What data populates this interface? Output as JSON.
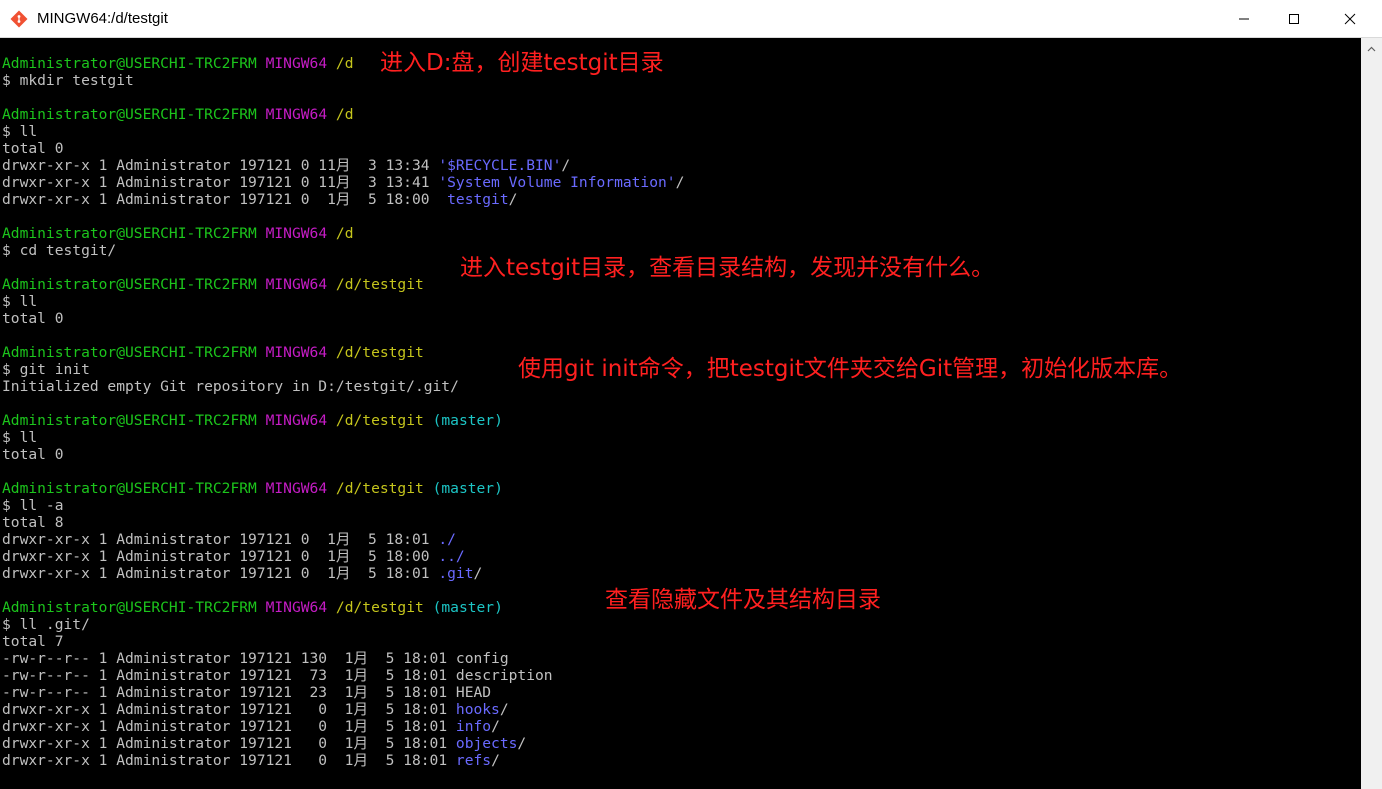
{
  "window": {
    "title": "MINGW64:/d/testgit",
    "minimize_icon": "minimize-icon",
    "maximize_icon": "maximize-icon",
    "close_icon": "close-icon"
  },
  "colors": {
    "background": "#000000",
    "prompt_user": "#1cc51c",
    "prompt_system": "#c51cc5",
    "prompt_path": "#c5c51c",
    "git_branch": "#1cc5c5",
    "directory": "#6a6aff",
    "text": "#c0c0c0",
    "annotation": "#ff2020"
  },
  "terminal": {
    "lines": [
      [
        [
          "Administrator@USERCHI-TRC2FRM",
          "green"
        ],
        [
          " ",
          "white"
        ],
        [
          "MINGW64",
          "magenta"
        ],
        [
          " ",
          "white"
        ],
        [
          "/d",
          "yellow"
        ]
      ],
      [
        [
          "$ mkdir testgit",
          "white"
        ]
      ],
      [],
      [
        [
          "Administrator@USERCHI-TRC2FRM",
          "green"
        ],
        [
          " ",
          "white"
        ],
        [
          "MINGW64",
          "magenta"
        ],
        [
          " ",
          "white"
        ],
        [
          "/d",
          "yellow"
        ]
      ],
      [
        [
          "$ ll",
          "white"
        ]
      ],
      [
        [
          "total 0",
          "white"
        ]
      ],
      [
        [
          "drwxr-xr-x 1 Administrator 197121 0 11月  3 13:34 ",
          "white"
        ],
        [
          "'$RECYCLE.BIN'",
          "blue"
        ],
        [
          "/",
          "white"
        ]
      ],
      [
        [
          "drwxr-xr-x 1 Administrator 197121 0 11月  3 13:41 ",
          "white"
        ],
        [
          "'System Volume Information'",
          "blue"
        ],
        [
          "/",
          "white"
        ]
      ],
      [
        [
          "drwxr-xr-x 1 Administrator 197121 0  1月  5 18:00  ",
          "white"
        ],
        [
          "testgit",
          "blue"
        ],
        [
          "/",
          "white"
        ]
      ],
      [],
      [
        [
          "Administrator@USERCHI-TRC2FRM",
          "green"
        ],
        [
          " ",
          "white"
        ],
        [
          "MINGW64",
          "magenta"
        ],
        [
          " ",
          "white"
        ],
        [
          "/d",
          "yellow"
        ]
      ],
      [
        [
          "$ cd testgit/",
          "white"
        ]
      ],
      [],
      [
        [
          "Administrator@USERCHI-TRC2FRM",
          "green"
        ],
        [
          " ",
          "white"
        ],
        [
          "MINGW64",
          "magenta"
        ],
        [
          " ",
          "white"
        ],
        [
          "/d/testgit",
          "yellow"
        ]
      ],
      [
        [
          "$ ll",
          "white"
        ]
      ],
      [
        [
          "total 0",
          "white"
        ]
      ],
      [],
      [
        [
          "Administrator@USERCHI-TRC2FRM",
          "green"
        ],
        [
          " ",
          "white"
        ],
        [
          "MINGW64",
          "magenta"
        ],
        [
          " ",
          "white"
        ],
        [
          "/d/testgit",
          "yellow"
        ]
      ],
      [
        [
          "$ git init",
          "white"
        ]
      ],
      [
        [
          "Initialized empty Git repository in D:/testgit/.git/",
          "white"
        ]
      ],
      [],
      [
        [
          "Administrator@USERCHI-TRC2FRM",
          "green"
        ],
        [
          " ",
          "white"
        ],
        [
          "MINGW64",
          "magenta"
        ],
        [
          " ",
          "white"
        ],
        [
          "/d/testgit",
          "yellow"
        ],
        [
          " ",
          "white"
        ],
        [
          "(master)",
          "cyan"
        ]
      ],
      [
        [
          "$ ll",
          "white"
        ]
      ],
      [
        [
          "total 0",
          "white"
        ]
      ],
      [],
      [
        [
          "Administrator@USERCHI-TRC2FRM",
          "green"
        ],
        [
          " ",
          "white"
        ],
        [
          "MINGW64",
          "magenta"
        ],
        [
          " ",
          "white"
        ],
        [
          "/d/testgit",
          "yellow"
        ],
        [
          " ",
          "white"
        ],
        [
          "(master)",
          "cyan"
        ]
      ],
      [
        [
          "$ ll -a",
          "white"
        ]
      ],
      [
        [
          "total 8",
          "white"
        ]
      ],
      [
        [
          "drwxr-xr-x 1 Administrator 197121 0  1月  5 18:01 ",
          "white"
        ],
        [
          "./",
          "blue"
        ]
      ],
      [
        [
          "drwxr-xr-x 1 Administrator 197121 0  1月  5 18:00 ",
          "white"
        ],
        [
          "../",
          "blue"
        ]
      ],
      [
        [
          "drwxr-xr-x 1 Administrator 197121 0  1月  5 18:01 ",
          "white"
        ],
        [
          ".git",
          "blue"
        ],
        [
          "/",
          "white"
        ]
      ],
      [],
      [
        [
          "Administrator@USERCHI-TRC2FRM",
          "green"
        ],
        [
          " ",
          "white"
        ],
        [
          "MINGW64",
          "magenta"
        ],
        [
          " ",
          "white"
        ],
        [
          "/d/testgit",
          "yellow"
        ],
        [
          " ",
          "white"
        ],
        [
          "(master)",
          "cyan"
        ]
      ],
      [
        [
          "$ ll .git/",
          "white"
        ]
      ],
      [
        [
          "total 7",
          "white"
        ]
      ],
      [
        [
          "-rw-r--r-- 1 Administrator 197121 130  1月  5 18:01 config",
          "white"
        ]
      ],
      [
        [
          "-rw-r--r-- 1 Administrator 197121  73  1月  5 18:01 description",
          "white"
        ]
      ],
      [
        [
          "-rw-r--r-- 1 Administrator 197121  23  1月  5 18:01 HEAD",
          "white"
        ]
      ],
      [
        [
          "drwxr-xr-x 1 Administrator 197121   0  1月  5 18:01 ",
          "white"
        ],
        [
          "hooks",
          "blue"
        ],
        [
          "/",
          "white"
        ]
      ],
      [
        [
          "drwxr-xr-x 1 Administrator 197121   0  1月  5 18:01 ",
          "white"
        ],
        [
          "info",
          "blue"
        ],
        [
          "/",
          "white"
        ]
      ],
      [
        [
          "drwxr-xr-x 1 Administrator 197121   0  1月  5 18:01 ",
          "white"
        ],
        [
          "objects",
          "blue"
        ],
        [
          "/",
          "white"
        ]
      ],
      [
        [
          "drwxr-xr-x 1 Administrator 197121   0  1月  5 18:01 ",
          "white"
        ],
        [
          "refs",
          "blue"
        ],
        [
          "/",
          "white"
        ]
      ]
    ]
  },
  "annotations": {
    "create_dir": "进入D:盘，创建testgit目录",
    "enter_dir": "进入testgit目录，查看目录结构，发现并没有什么。",
    "git_init": "使用git init命令，把testgit文件夹交给Git管理，初始化版本库。",
    "hidden_files": "查看隐藏文件及其结构目录"
  }
}
